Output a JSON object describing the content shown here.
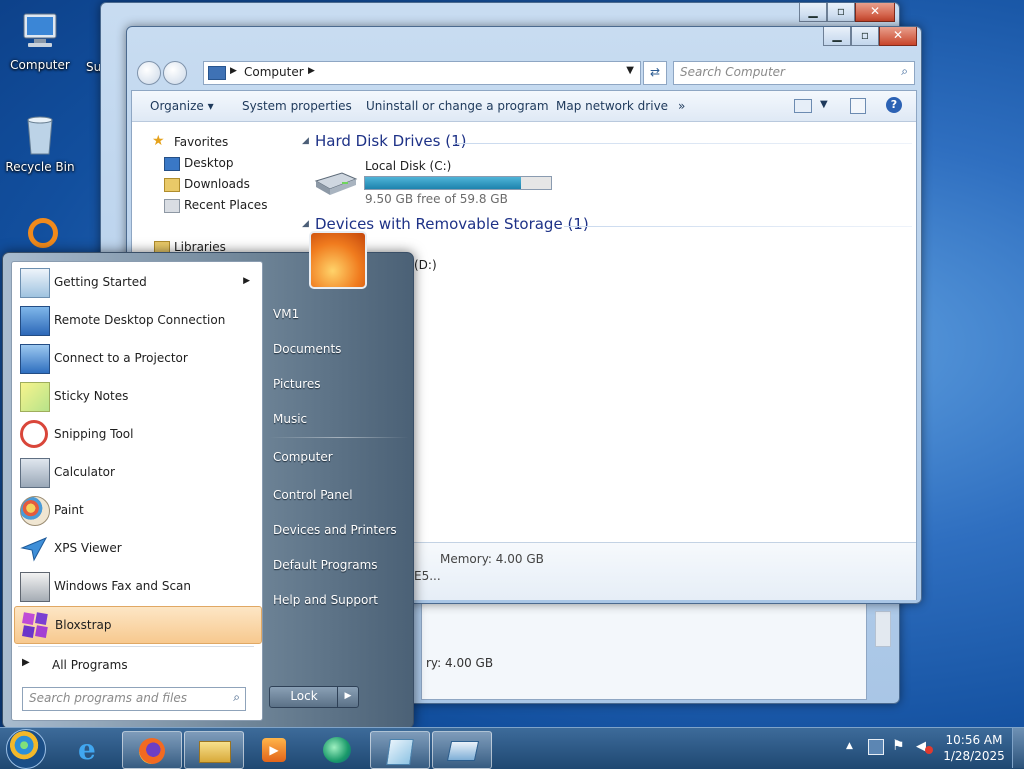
{
  "desktop": {
    "icons": [
      {
        "label": "Computer"
      },
      {
        "label": "Su"
      },
      {
        "label": "Recycle Bin"
      }
    ]
  },
  "explorer": {
    "address": "Computer",
    "search_placeholder": "Search Computer",
    "toolbar": {
      "organize": "Organize",
      "system_properties": "System properties",
      "uninstall": "Uninstall or change a program",
      "map_drive": "Map network drive",
      "more": "»"
    },
    "nav": {
      "favorites": "Favorites",
      "desktop": "Desktop",
      "downloads": "Downloads",
      "recent": "Recent Places",
      "libraries": "Libraries"
    },
    "groups": {
      "hdd": "Hard Disk Drives (1)",
      "removable": "Devices with Removable Storage (1)"
    },
    "disk": {
      "name": "Local Disk (C:)",
      "free_text": "9.50 GB free of 59.8 GB",
      "used_fraction": 0.84
    },
    "dvd_label": "(D:)",
    "details": {
      "memory": "Memory:  4.00 GB",
      "processor_fragment": "E5..."
    }
  },
  "back_window": {
    "memory_fragment": "ry:  4.00 GB"
  },
  "start_menu": {
    "programs": [
      {
        "label": "Getting Started",
        "icon": "getting-started-icon",
        "arrow": "▶"
      },
      {
        "label": "Remote Desktop Connection",
        "icon": "remote-desktop-icon"
      },
      {
        "label": "Connect to a Projector",
        "icon": "projector-icon"
      },
      {
        "label": "Sticky Notes",
        "icon": "sticky-notes-icon"
      },
      {
        "label": "Snipping Tool",
        "icon": "snipping-tool-icon"
      },
      {
        "label": "Calculator",
        "icon": "calculator-icon"
      },
      {
        "label": "Paint",
        "icon": "paint-icon"
      },
      {
        "label": "XPS Viewer",
        "icon": "xps-viewer-icon"
      },
      {
        "label": "Windows Fax and Scan",
        "icon": "fax-scan-icon"
      },
      {
        "label": "Bloxstrap",
        "icon": "bloxstrap-icon"
      }
    ],
    "all_programs": "All Programs",
    "search_placeholder": "Search programs and files",
    "right": {
      "user": "VM1",
      "documents": "Documents",
      "pictures": "Pictures",
      "music": "Music",
      "computer": "Computer",
      "control_panel": "Control Panel",
      "devices": "Devices and Printers",
      "default_programs": "Default Programs",
      "help": "Help and Support"
    },
    "lock": "Lock"
  },
  "taskbar": {
    "time": "10:56 AM",
    "date": "1/28/2025"
  }
}
